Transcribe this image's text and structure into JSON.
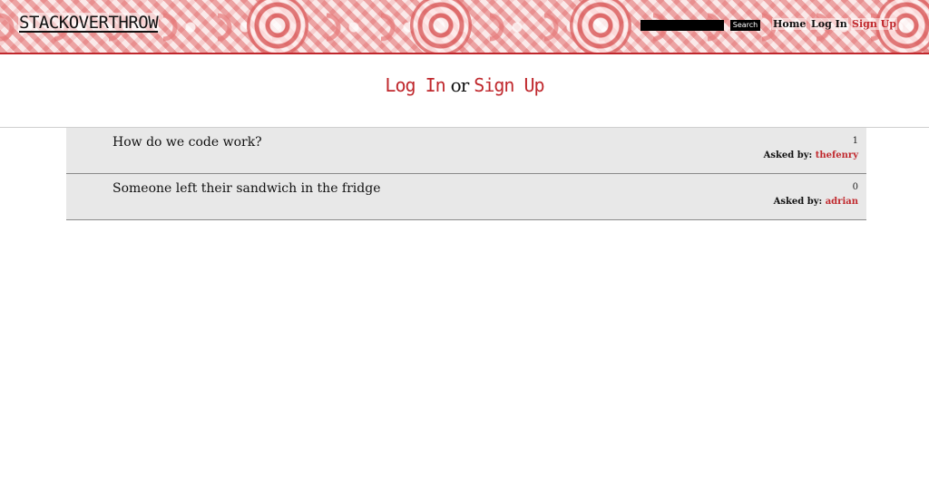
{
  "header": {
    "logo": "STACKOVERTHROW",
    "search": {
      "value": "",
      "placeholder": ""
    },
    "search_button": "Search",
    "nav": {
      "home": "Home",
      "login": "Log In",
      "signup": "Sign Up"
    }
  },
  "auth": {
    "login": "Log In",
    "or": "or",
    "signup": "Sign Up"
  },
  "questions": [
    {
      "title": "How do we code work?",
      "votes": "1",
      "asked_by_label": "Asked by:",
      "author": "thefenry"
    },
    {
      "title": "Someone left their sandwich in the fridge",
      "votes": "0",
      "asked_by_label": "Asked by:",
      "author": "adrian"
    }
  ],
  "colors": {
    "accent": "#c0282d",
    "row_bg": "#e8e8e8",
    "header_pattern": "#e88a8a"
  }
}
